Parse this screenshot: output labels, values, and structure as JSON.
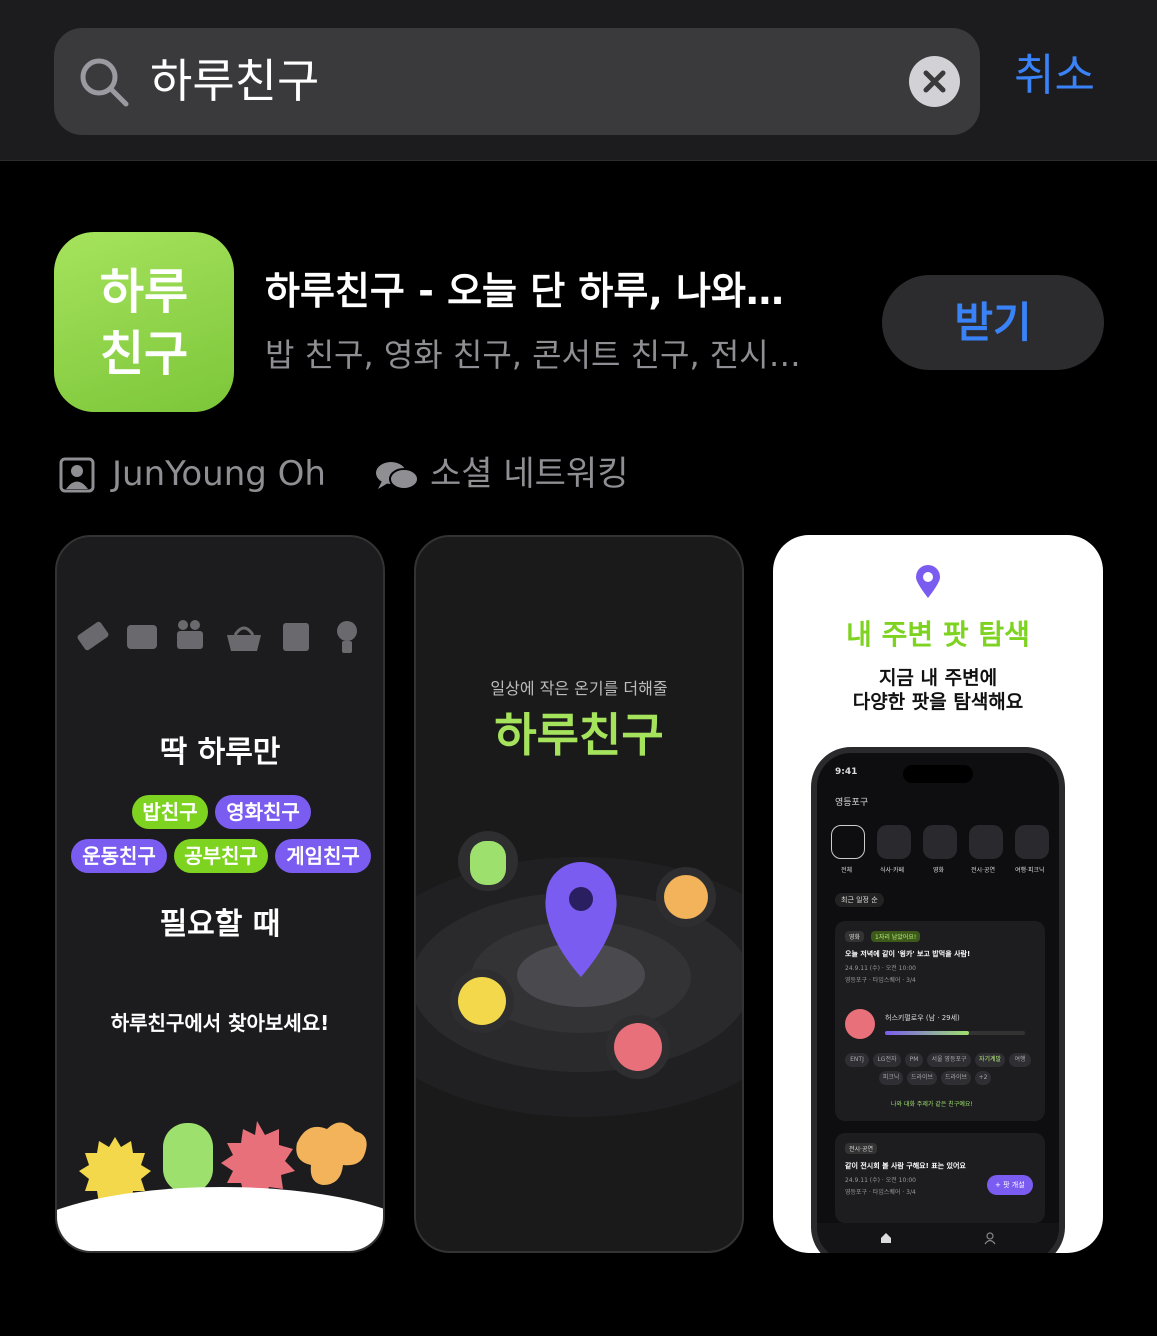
{
  "search": {
    "query": "하루친구",
    "cancel_label": "취소"
  },
  "app": {
    "icon_text_line1": "하루",
    "icon_text_line2": "친구",
    "title": "하루친구 - 오늘 단 하루, 나와…",
    "subtitle": "밥 친구, 영화 친구, 콘서트 친구, 전시…",
    "get_label": "받기",
    "developer": "JunYoung Oh",
    "category": "소셜 네트워킹"
  },
  "screenshots": {
    "shot1": {
      "heading1": "딱 하루만",
      "pills": [
        "밥친구",
        "영화친구",
        "운동친구",
        "공부친구",
        "게임친구"
      ],
      "heading2": "필요할 때",
      "footer": "하루친구에서 찾아보세요!"
    },
    "shot2": {
      "small": "일상에 작은 온기를 더해줄",
      "big": "하루친구"
    },
    "shot3": {
      "title": "내 주변 팟 탐색",
      "sub1": "지금 내 주변에",
      "sub2": "다양한 팟을 탐색해요",
      "phone": {
        "time": "9:41",
        "location": "영등포구",
        "sort": "최근 일정 순",
        "card1_tag": "영화",
        "card1_badge": "1자리 남았어요!",
        "card1_title": "오늘 저녁에 같이 '윙카' 보고 밥먹을 사람!",
        "card1_date": "24.9.11 (수) · 오전 10:00",
        "card1_place": "영등포구 · 타임스퀘어 · 3/4",
        "user_name": "허스키펄로우 (남 · 29세)",
        "card1_footer": "나와 대화 주제가 같은 친구예요!",
        "card2_tag": "전시·공연",
        "card2_title": "같이 전시회 볼 사람 구해요! 표는 있어요",
        "card2_date": "24.9.11 (수) · 오전 10:00",
        "card2_place": "영등포구 · 타임스퀘어 · 3/4",
        "fab": "+ 팟 개설",
        "cats": [
          "전체",
          "식사·카페",
          "영화",
          "전시·공연",
          "여행·피크닉"
        ],
        "chips": [
          "ENTJ",
          "LG전자",
          "PM",
          "서울 영등포구",
          "자기계발",
          "여행",
          "피크닉",
          "드라이브",
          "드라이브",
          "+2"
        ]
      }
    }
  },
  "colors": {
    "accent_blue": "#3a82f7",
    "brand_green": "#7ed321",
    "brand_purple": "#7b5cf0"
  }
}
